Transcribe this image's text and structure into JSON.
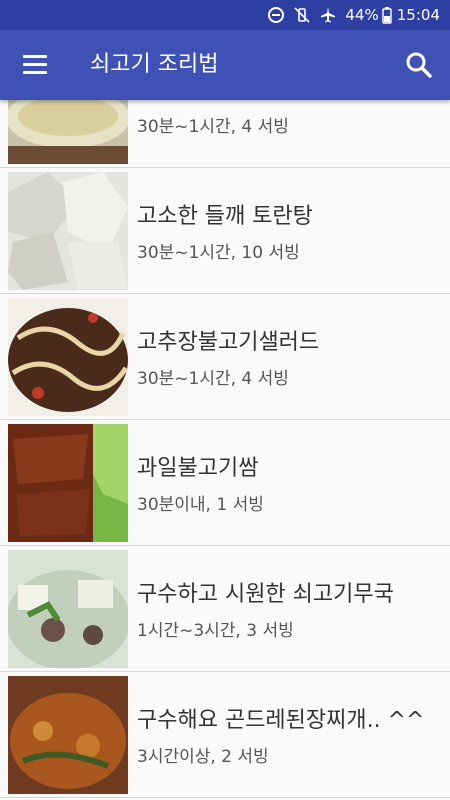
{
  "status": {
    "battery": "44%",
    "time": "15:04"
  },
  "appbar": {
    "title": "쇠고기 조리법"
  },
  "recipes": [
    {
      "title": "",
      "meta": "30분~1시간, 4 서빙"
    },
    {
      "title": "고소한 들깨 토란탕",
      "meta": "30분~1시간, 10 서빙"
    },
    {
      "title": "고추장불고기샐러드",
      "meta": "30분~1시간, 4 서빙"
    },
    {
      "title": "과일불고기쌈",
      "meta": "30분이내, 1 서빙"
    },
    {
      "title": "구수하고 시원한 쇠고기무국",
      "meta": "1시간~3시간, 3 서빙"
    },
    {
      "title": "구수해요 곤드레된장찌개.. ^^",
      "meta": "3시간이상, 2 서빙"
    }
  ],
  "icons": [
    "do-not-disturb-icon",
    "vibrate-icon",
    "airplane-icon",
    "battery-icon",
    "menu-icon",
    "search-icon"
  ]
}
